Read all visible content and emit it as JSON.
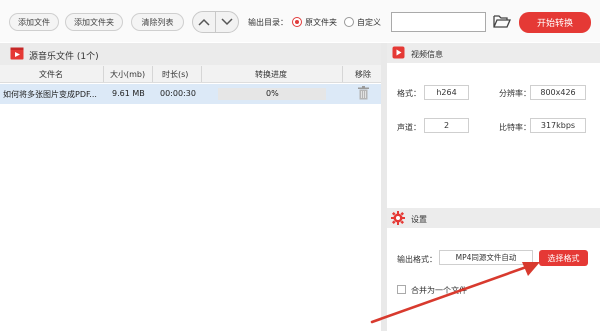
{
  "toolbar": {
    "add_file": "添加文件",
    "add_folder": "添加文件夹",
    "clear_list": "清除列表",
    "output_label": "输出目录：",
    "option_source": "原文件夹",
    "option_custom": "自定义",
    "output_path": "",
    "start_label": "开始转换"
  },
  "file_panel": {
    "title": "源音乐文件 (1个)",
    "columns": [
      "文件名",
      "大小(mb)",
      "时长(s)",
      "转换进度",
      "移除"
    ],
    "rows": [
      {
        "name": "如何将多张图片变成PDF...",
        "size": "9.61 MB",
        "duration": "00:00:30",
        "progress": "0%",
        "progress_value": 0
      }
    ]
  },
  "video_info": {
    "title": "视频信息",
    "format_label": "格式：",
    "format_value": "h264",
    "resolution_label": "分辨率：",
    "resolution_value": "800x426",
    "channels_label": "声道：",
    "channels_value": "2",
    "bitrate_label": "比特率：",
    "bitrate_value": "317kbps"
  },
  "settings": {
    "title": "设置",
    "output_format_label": "输出格式：",
    "output_format_value": "MP4同源文件自动",
    "choose_format_label": "选择格式",
    "merge_label": "合并为一个文件",
    "merge_checked": false
  },
  "colors": {
    "accent": "#e53935",
    "selected_row": "#dce9f7",
    "panel_header": "#ebebeb"
  },
  "icons": [
    "chevron-up-icon",
    "chevron-down-icon",
    "folder-open-icon",
    "video-file-icon",
    "trash-icon",
    "gear-icon",
    "arrow-annotation"
  ]
}
